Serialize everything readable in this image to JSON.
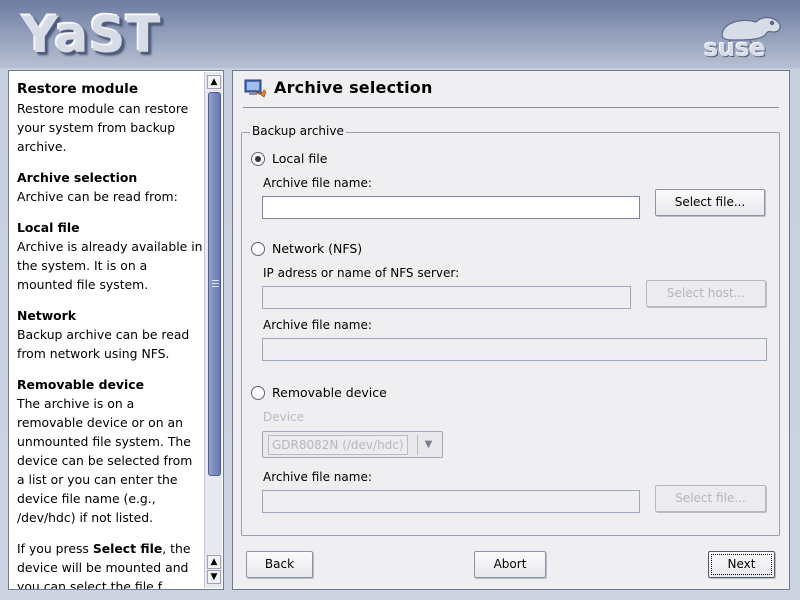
{
  "header": {
    "logo_text": "YaST",
    "vendor_logo": "suse"
  },
  "help": {
    "blocks": [
      {
        "title": "Restore module",
        "text": "Restore module can restore your system from backup archive."
      },
      {
        "title": "Archive selection",
        "text": "Archive can be read from:"
      },
      {
        "title": "Local file",
        "text": "Archive is already available in the system. It is on a mounted file system."
      },
      {
        "title": "Network",
        "text": "Backup archive can be read from network using NFS."
      },
      {
        "title": "Removable device",
        "text": "The archive is on a removable device or on an unmounted file system. The device can be selected from a list or you can enter the device file name (e.g., /dev/hdc) if not listed."
      }
    ],
    "last_pre": "If you press ",
    "last_bold": "Select file",
    "last_post": ", the device will be mounted and you can select the file f..."
  },
  "main": {
    "title": "Archive selection",
    "group_label": "Backup archive",
    "local": {
      "radio_label": "Local file",
      "checked": true,
      "field_label": "Archive file name:",
      "field_value": "",
      "button_label": "Select file..."
    },
    "network": {
      "radio_label": "Network (NFS)",
      "checked": false,
      "server_label": "IP adress or name of NFS server:",
      "server_value": "",
      "host_button_label": "Select host...",
      "file_label": "Archive file name:",
      "file_value": ""
    },
    "removable": {
      "radio_label": "Removable device",
      "checked": false,
      "device_label": "Device",
      "device_value": "GDR8082N (/dev/hdc)",
      "file_label": "Archive file name:",
      "file_value": "",
      "button_label": "Select file..."
    }
  },
  "footer": {
    "back": "Back",
    "abort": "Abort",
    "next": "Next"
  }
}
